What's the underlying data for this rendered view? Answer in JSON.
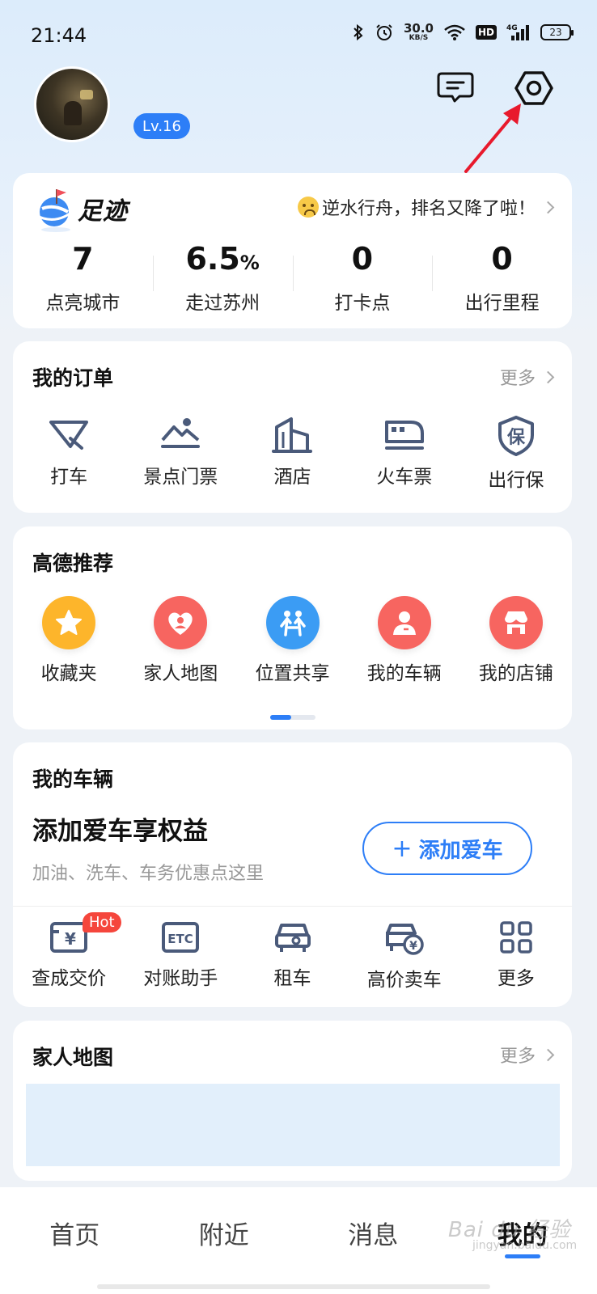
{
  "status_bar": {
    "time": "21:44",
    "net_speed": "30.0",
    "net_unit": "KB/S",
    "hd": "HD",
    "network": "4G",
    "battery": "23"
  },
  "profile": {
    "level": "Lv.16"
  },
  "footprint": {
    "title": "足迹",
    "notice": "逆水行舟，排名又降了啦！",
    "stats": [
      {
        "value": "7",
        "unit": "",
        "label": "点亮城市"
      },
      {
        "value": "6.5",
        "unit": "%",
        "label": "走过苏州"
      },
      {
        "value": "0",
        "unit": "",
        "label": "打卡点"
      },
      {
        "value": "0",
        "unit": "",
        "label": "出行里程"
      }
    ]
  },
  "orders": {
    "title": "我的订单",
    "more": "更多",
    "items": [
      {
        "label": "打车",
        "icon": "taxi-icon"
      },
      {
        "label": "景点门票",
        "icon": "scenic-ticket-icon"
      },
      {
        "label": "酒店",
        "icon": "hotel-icon"
      },
      {
        "label": "火车票",
        "icon": "train-icon"
      },
      {
        "label": "出行保",
        "icon": "insurance-shield-icon",
        "glyph": "保"
      }
    ]
  },
  "recommend": {
    "title": "高德推荐",
    "items": [
      {
        "label": "收藏夹",
        "icon": "star-icon",
        "color": "#fdb52b"
      },
      {
        "label": "家人地图",
        "icon": "heart-icon",
        "color": "#f76560"
      },
      {
        "label": "位置共享",
        "icon": "people-icon",
        "color": "#3b9cf4"
      },
      {
        "label": "我的车辆",
        "icon": "person-icon",
        "color": "#f76560"
      },
      {
        "label": "我的店铺",
        "icon": "shop-icon",
        "color": "#f76560"
      }
    ],
    "page_index": 1,
    "page_count": 2
  },
  "vehicle": {
    "title": "我的车辆",
    "promo_title": "添加爱车享权益",
    "promo_sub": "加油、洗车、车务优惠点这里",
    "add_button": "添加爱车",
    "hot_badge": "Hot",
    "tools": [
      {
        "label": "查成交价",
        "icon": "price-check-icon",
        "glyph": "¥"
      },
      {
        "label": "对账助手",
        "icon": "etc-icon",
        "glyph": "ETC"
      },
      {
        "label": "租车",
        "icon": "car-rental-icon"
      },
      {
        "label": "高价卖车",
        "icon": "car-sell-icon",
        "glyph": "¥"
      },
      {
        "label": "更多",
        "icon": "grid-more-icon"
      }
    ]
  },
  "family_map": {
    "title": "家人地图",
    "more": "更多"
  },
  "bottom_nav": {
    "items": [
      {
        "label": "首页",
        "active": false
      },
      {
        "label": "附近",
        "active": false
      },
      {
        "label": "消息",
        "active": false
      },
      {
        "label": "我的",
        "active": true
      }
    ]
  },
  "watermark": {
    "text": "Bai du 经验",
    "sub": "jingyan.baidu.com"
  },
  "colors": {
    "accent": "#2d7ef7",
    "icon_stroke": "#4a5a7a",
    "annotation": "#e8192c"
  }
}
